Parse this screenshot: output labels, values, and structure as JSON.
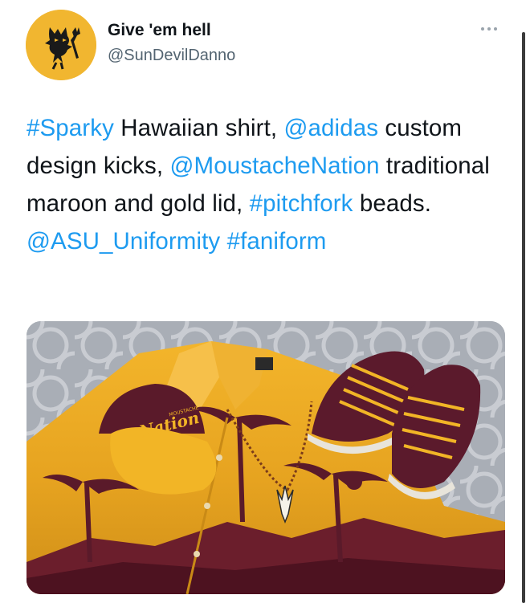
{
  "author": {
    "display_name": "Give 'em hell",
    "handle": "@SunDevilDanno"
  },
  "tweet": {
    "segments": [
      {
        "text": "#Sparky",
        "link": true
      },
      {
        "text": " Hawaiian shirt, ",
        "link": false
      },
      {
        "text": "@adidas",
        "link": true
      },
      {
        "text": " custom design kicks, ",
        "link": false
      },
      {
        "text": "@MoustacheNation",
        "link": true
      },
      {
        "text": " traditional maroon and gold lid, ",
        "link": false
      },
      {
        "text": "#pitchfork",
        "link": true
      },
      {
        "text": " beads. ",
        "link": false
      },
      {
        "text": "@ASU_Uniformity",
        "link": true
      },
      {
        "text": " ",
        "link": false
      },
      {
        "text": "#faniform",
        "link": true
      }
    ]
  },
  "media": {
    "hat_script": "Nation",
    "hat_small": "MOUSTACHE"
  },
  "colors": {
    "link": "#1d9bf0",
    "gold": "#f1b630",
    "maroon": "#5a1a2a"
  },
  "icons": {
    "avatar": "sun-devil-logo-icon",
    "menu": "more-options-icon"
  }
}
